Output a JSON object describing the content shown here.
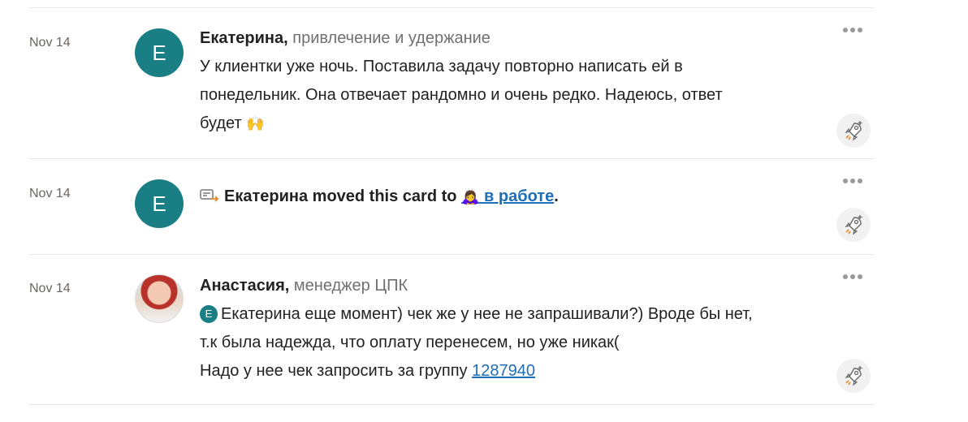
{
  "entries": [
    {
      "date": "Nov 14",
      "avatar_letter": "E",
      "author": "Екатерина,",
      "role": "привлечение и удержание",
      "lines": [
        "У клиентки уже ночь. Поставила задачу повторно написать ей в",
        "понедельник. Она отвечает рандомно и очень редко. Надеюсь, ответ",
        "будет"
      ],
      "emoji": "🙌"
    },
    {
      "date": "Nov 14",
      "avatar_letter": "E",
      "action_text": "Екатерина moved this card to",
      "list_emoji": "🙇‍♀️",
      "list_name": "в работе",
      "trailing": "."
    },
    {
      "date": "Nov 14",
      "author": "Анастасия,",
      "role": "менеджер ЦПК",
      "mention_letter": "E",
      "line1": "Екатерина еще момент) чек же у нее не запрашивали?) Вроде бы нет,",
      "line2": "т.к была надежда, что оплату перенесем, но уже никак(",
      "line3_text": "Надо у нее чек запросить за группу",
      "group_link": "1287940"
    }
  ],
  "icons": {
    "menu": "more-dots-icon",
    "reaction": "rocket-add-reaction-icon",
    "moved": "card-move-icon"
  }
}
